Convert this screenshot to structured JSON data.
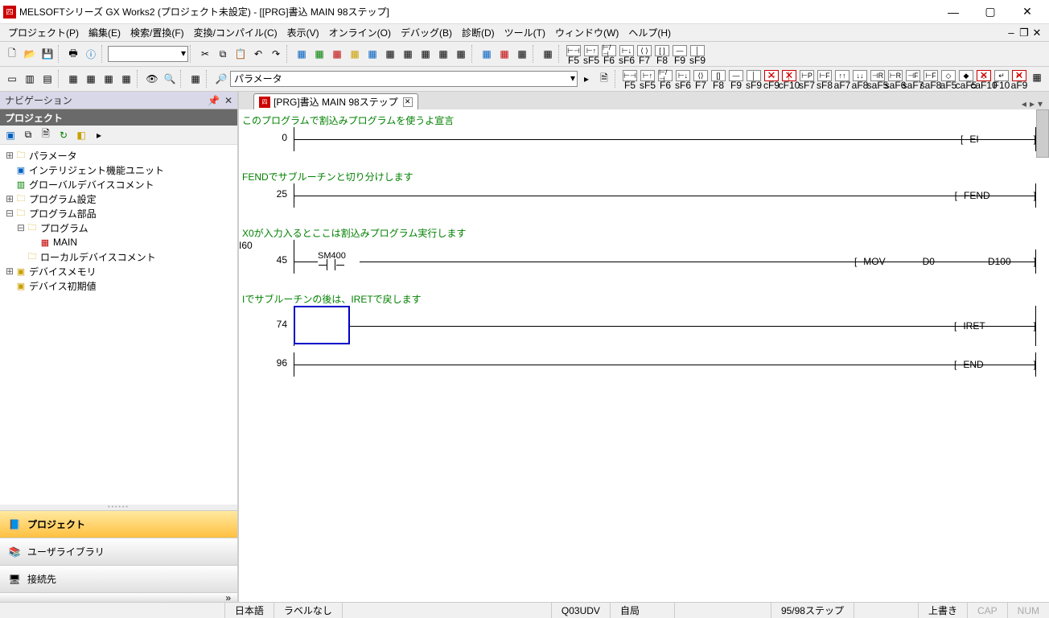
{
  "title": "MELSOFTシリーズ GX Works2 (プロジェクト未設定) - [[PRG]書込 MAIN 98ステップ]",
  "menu": {
    "project": "プロジェクト(P)",
    "edit": "編集(E)",
    "find": "検索/置換(F)",
    "compile": "変換/コンパイル(C)",
    "view": "表示(V)",
    "online": "オンライン(O)",
    "debug": "デバッグ(B)",
    "diag": "診断(D)",
    "tool": "ツール(T)",
    "window": "ウィンドウ(W)",
    "help": "ヘルプ(H)"
  },
  "combo_param": "パラメータ",
  "func_row1": [
    "F5",
    "sF5",
    "F6",
    "sF6",
    "F7",
    "F8",
    "F9",
    "sF9"
  ],
  "func_row2": [
    "F5",
    "sF5",
    "F6",
    "sF6",
    "F7",
    "F8",
    "F9",
    "sF9",
    "cF9",
    "cF10",
    "sF7",
    "sF8",
    "aF7",
    "aF8",
    "saF5",
    "saF6",
    "saF7",
    "saF8",
    "aF5",
    "caF5",
    "caF10",
    "F10",
    "aF9"
  ],
  "nav": {
    "title": "ナビゲーション",
    "section": "プロジェクト",
    "cat_project": "プロジェクト",
    "cat_userlib": "ユーザライブラリ",
    "cat_conn": "接続先"
  },
  "tree": {
    "param": "パラメータ",
    "intel": "インテリジェント機能ユニット",
    "global": "グローバルデバイスコメント",
    "progset": "プログラム設定",
    "progpart": "プログラム部品",
    "program": "プログラム",
    "main": "MAIN",
    "localcom": "ローカルデバイスコメント",
    "devmem": "デバイスメモリ",
    "devinit": "デバイス初期値"
  },
  "tab": {
    "label": "[PRG]書込 MAIN 98ステップ"
  },
  "ladder": {
    "c1": "このプログラムで割込みプログラムを使うよ宣言",
    "s1": "0",
    "o1": "EI",
    "c2": "FENDでサブルーチンと切り分けします",
    "s2": "25",
    "o2": "FEND",
    "c3": "X0が入力入るとここは割込みプログラム実行します",
    "ptr": "I60",
    "s3": "45",
    "dev3": "SM400",
    "o3": "MOV",
    "o3s": "D0",
    "o3d": "D100",
    "c4": "Iでサブルーチンの後は、IRETで戻します",
    "s4": "74",
    "o4": "IRET",
    "s5": "96",
    "o5": "END"
  },
  "status": {
    "lang": "日本語",
    "label": "ラベルなし",
    "cpu": "Q03UDV",
    "host": "自局",
    "step": "95/98ステップ",
    "mode": "上書き",
    "cap": "CAP",
    "num": "NUM"
  }
}
